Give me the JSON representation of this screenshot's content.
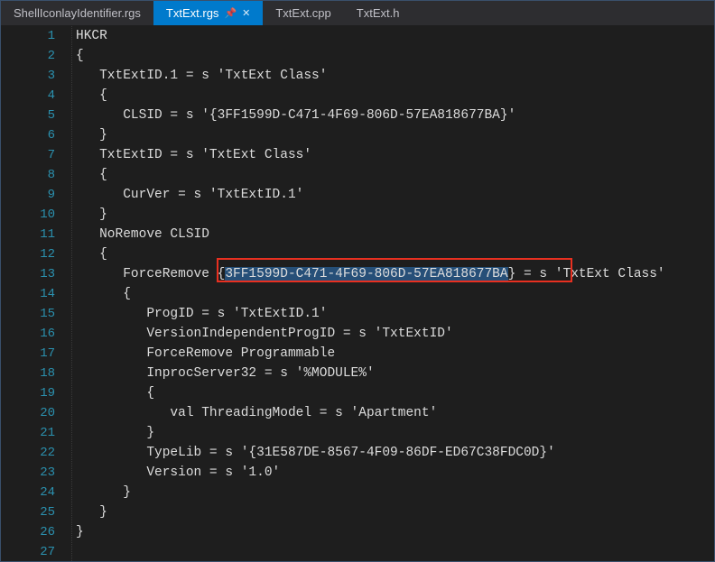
{
  "tabs": [
    {
      "label": "ShellIconlayIdentifier.rgs",
      "active": false
    },
    {
      "label": "TxtExt.rgs",
      "active": true,
      "pinned": true
    },
    {
      "label": "TxtExt.cpp",
      "active": false
    },
    {
      "label": "TxtExt.h",
      "active": false
    }
  ],
  "lineNumbers": [
    "1",
    "2",
    "3",
    "4",
    "5",
    "6",
    "7",
    "8",
    "9",
    "10",
    "11",
    "12",
    "13",
    "14",
    "15",
    "16",
    "17",
    "18",
    "19",
    "20",
    "21",
    "22",
    "23",
    "24",
    "25",
    "26",
    "27"
  ],
  "code": {
    "l1": "HKCR",
    "l2": "{",
    "l3": "   TxtExtID.1 = s 'TxtExt Class'",
    "l4": "   {",
    "l5": "      CLSID = s '{3FF1599D-C471-4F69-806D-57EA818677BA}'",
    "l6": "   }",
    "l7": "   TxtExtID = s 'TxtExt Class'",
    "l8": "   {",
    "l9": "      CurVer = s 'TxtExtID.1'",
    "l10": "   }",
    "l11": "   NoRemove CLSID",
    "l12": "   {",
    "l13a": "      ForceRemove {",
    "l13sel": "3FF1599D-C471-4F69-806D-57EA818677BA",
    "l13b": "} = s 'TxtExt Class'",
    "l14": "      {",
    "l15": "         ProgID = s 'TxtExtID.1'",
    "l16": "         VersionIndependentProgID = s 'TxtExtID'",
    "l17": "         ForceRemove Programmable",
    "l18": "         InprocServer32 = s '%MODULE%'",
    "l19": "         {",
    "l20": "            val ThreadingModel = s 'Apartment'",
    "l21": "         }",
    "l22": "         TypeLib = s '{31E587DE-8567-4F09-86DF-ED67C38FDC0D}'",
    "l23": "         Version = s '1.0'",
    "l24": "      }",
    "l25": "   }",
    "l26": "}",
    "l27": ""
  },
  "icons": {
    "pin": "📌",
    "close": "✕"
  }
}
